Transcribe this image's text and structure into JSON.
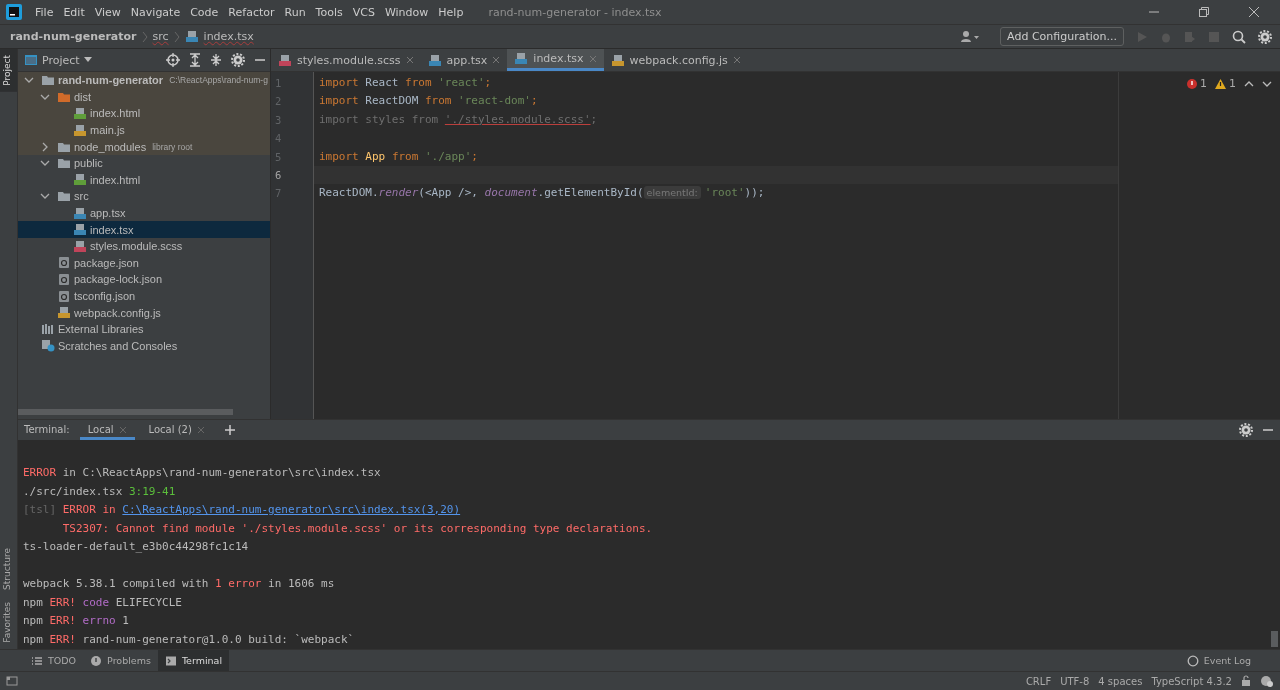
{
  "menu_bar": {
    "items": [
      "File",
      "Edit",
      "View",
      "Navigate",
      "Code",
      "Refactor",
      "Run",
      "Tools",
      "VCS",
      "Window",
      "Help"
    ],
    "title": "rand-num-generator - index.tsx"
  },
  "nav_bar": {
    "breadcrumbs": [
      {
        "label": "rand-num-generator",
        "kind": "project"
      },
      {
        "label": "src",
        "kind": "folder"
      },
      {
        "label": "index.tsx",
        "kind": "tsx"
      }
    ],
    "config_button": "Add Configuration..."
  },
  "left_stripe": {
    "top": [
      {
        "label": "Project",
        "selected": true
      }
    ],
    "bottom": [
      {
        "label": "Structure",
        "selected": false
      },
      {
        "label": "Favorites",
        "selected": false
      }
    ]
  },
  "project_panel": {
    "title": "Project",
    "tree": [
      {
        "label": "rand-num-generator",
        "kind": "folder",
        "bold": true,
        "hint": "C:\\ReactApps\\rand-num-g",
        "expanded": true,
        "selected": false,
        "excluded": true,
        "children": [
          {
            "label": "dist",
            "kind": "excluded-folder",
            "expanded": true,
            "selected": false,
            "excluded": true,
            "children": [
              {
                "label": "index.html",
                "kind": "html",
                "selected": false,
                "excluded": true
              },
              {
                "label": "main.js",
                "kind": "js",
                "selected": false,
                "excluded": true
              }
            ]
          },
          {
            "label": "node_modules",
            "kind": "folder",
            "hint": "library root",
            "expanded": false,
            "selected": false,
            "excluded": true
          },
          {
            "label": "public",
            "kind": "folder",
            "expanded": true,
            "selected": false,
            "excluded": false,
            "children": [
              {
                "label": "index.html",
                "kind": "html",
                "selected": false,
                "excluded": false
              }
            ]
          },
          {
            "label": "src",
            "kind": "folder",
            "expanded": true,
            "selected": false,
            "excluded": false,
            "children": [
              {
                "label": "app.tsx",
                "kind": "tsx",
                "selected": false,
                "excluded": false
              },
              {
                "label": "index.tsx",
                "kind": "tsx",
                "selected": true,
                "excluded": false
              },
              {
                "label": "styles.module.scss",
                "kind": "scss",
                "selected": false,
                "excluded": false
              }
            ]
          },
          {
            "label": "package.json",
            "kind": "json",
            "selected": false,
            "excluded": false
          },
          {
            "label": "package-lock.json",
            "kind": "json",
            "selected": false,
            "excluded": false
          },
          {
            "label": "tsconfig.json",
            "kind": "json",
            "selected": false,
            "excluded": false
          },
          {
            "label": "webpack.config.js",
            "kind": "js",
            "selected": false,
            "excluded": false
          }
        ]
      },
      {
        "label": "External Libraries",
        "kind": "lib",
        "selected": false,
        "excluded": false
      },
      {
        "label": "Scratches and Consoles",
        "kind": "scratch",
        "selected": false,
        "excluded": false
      }
    ]
  },
  "editor_tabs": [
    {
      "label": "styles.module.scss",
      "kind": "scss",
      "selected": false
    },
    {
      "label": "app.tsx",
      "kind": "tsx",
      "selected": false
    },
    {
      "label": "index.tsx",
      "kind": "tsx",
      "selected": true
    },
    {
      "label": "webpack.config.js",
      "kind": "js",
      "selected": false
    }
  ],
  "inspections": {
    "errors": "1",
    "warnings": "1"
  },
  "code_lines": [
    {
      "number": "1",
      "current": false,
      "tokens": [
        {
          "text": "import",
          "kind": "kw"
        },
        {
          "text": " React ",
          "kind": "id"
        },
        {
          "text": "from",
          "kind": "kw"
        },
        {
          "text": " 'react'",
          "kind": "str"
        },
        {
          "text": ";",
          "kind": "kw"
        }
      ]
    },
    {
      "number": "2",
      "current": false,
      "tokens": [
        {
          "text": "import",
          "kind": "kw"
        },
        {
          "text": " ReactDOM ",
          "kind": "id"
        },
        {
          "text": "from",
          "kind": "kw"
        },
        {
          "text": " 'react-dom'",
          "kind": "str"
        },
        {
          "text": ";",
          "kind": "kw"
        }
      ]
    },
    {
      "number": "3",
      "current": false,
      "tokens": [
        {
          "text": "import styles from ",
          "kind": "dim"
        },
        {
          "text": "'./styles.module.scss'",
          "kind": "err"
        },
        {
          "text": ";",
          "kind": "dim"
        }
      ]
    },
    {
      "number": "4",
      "current": false
    },
    {
      "number": "5",
      "current": false,
      "tokens": [
        {
          "text": "import",
          "kind": "kw"
        },
        {
          "text": " App ",
          "kind": "fn"
        },
        {
          "text": "from",
          "kind": "kw"
        },
        {
          "text": " './app'",
          "kind": "str"
        },
        {
          "text": ";",
          "kind": "kw"
        }
      ]
    },
    {
      "number": "6",
      "current": true
    },
    {
      "number": "7",
      "current": false,
      "tokens": [
        {
          "text": "ReactDOM.",
          "kind": "id"
        },
        {
          "text": "render",
          "kind": "member"
        },
        {
          "text": "(<App />, ",
          "kind": "id"
        },
        {
          "text": "document",
          "kind": "member"
        },
        {
          "text": ".getElementById(",
          "kind": "id"
        },
        {
          "text": "elementId:",
          "kind": "hint"
        },
        {
          "text": "'root'",
          "kind": "str"
        },
        {
          "text": "));",
          "kind": "id"
        }
      ]
    }
  ],
  "terminal": {
    "label": "Terminal:",
    "tabs": [
      {
        "label": "Local",
        "selected": true
      },
      {
        "label": "Local (2)",
        "selected": false
      }
    ],
    "lines": [
      {
        "kind": "blank"
      },
      {
        "kind": "text",
        "segments": [
          {
            "text": "ERROR",
            "kind": "err"
          },
          {
            "text": " in C:\\ReactApps\\rand-num-generator\\src\\index.tsx",
            "kind": "plain"
          }
        ]
      },
      {
        "kind": "text",
        "segments": [
          {
            "text": "./src/index.tsx ",
            "kind": "plain"
          },
          {
            "text": "3:19-41",
            "kind": "ok"
          }
        ]
      },
      {
        "kind": "text",
        "segments": [
          {
            "text": "[tsl] ",
            "kind": "dim"
          },
          {
            "text": "ERROR in ",
            "kind": "err"
          },
          {
            "text": "C:\\ReactApps\\rand-num-generator\\src\\index.tsx(3,20)",
            "kind": "link"
          }
        ]
      },
      {
        "kind": "text",
        "segments": [
          {
            "text": "      TS2307: Cannot find module './styles.module.scss' or its corresponding type declarations.",
            "kind": "err"
          }
        ]
      },
      {
        "kind": "text",
        "segments": [
          {
            "text": "ts-loader-default_e3b0c44298fc1c14",
            "kind": "plain"
          }
        ]
      },
      {
        "kind": "blank"
      },
      {
        "kind": "text",
        "segments": [
          {
            "text": "webpack 5.38.1 compiled with ",
            "kind": "plain"
          },
          {
            "text": "1 error",
            "kind": "err"
          },
          {
            "text": " in 1606 ms",
            "kind": "plain"
          }
        ]
      },
      {
        "kind": "text",
        "segments": [
          {
            "text": "npm ",
            "kind": "plain"
          },
          {
            "text": "ERR!",
            "kind": "err"
          },
          {
            "text": " code",
            "kind": "purple"
          },
          {
            "text": " ELIFECYCLE",
            "kind": "plain"
          }
        ]
      },
      {
        "kind": "text",
        "segments": [
          {
            "text": "npm ",
            "kind": "plain"
          },
          {
            "text": "ERR!",
            "kind": "err"
          },
          {
            "text": " errno",
            "kind": "purple"
          },
          {
            "text": " 1",
            "kind": "plain"
          }
        ]
      },
      {
        "kind": "text",
        "segments": [
          {
            "text": "npm ",
            "kind": "plain"
          },
          {
            "text": "ERR!",
            "kind": "err"
          },
          {
            "text": " rand-num-generator@1.0.0 build: `webpack`",
            "kind": "plain"
          }
        ]
      }
    ]
  },
  "tool_tabs": [
    {
      "label": "TODO",
      "kind": "list",
      "selected": false
    },
    {
      "label": "Problems",
      "kind": "problems",
      "selected": false
    },
    {
      "label": "Terminal",
      "kind": "terminal",
      "selected": true
    }
  ],
  "event_log": "Event Log",
  "status_bar": [
    "CRLF",
    "UTF-8",
    "4 spaces",
    "TypeScript 4.3.2"
  ]
}
